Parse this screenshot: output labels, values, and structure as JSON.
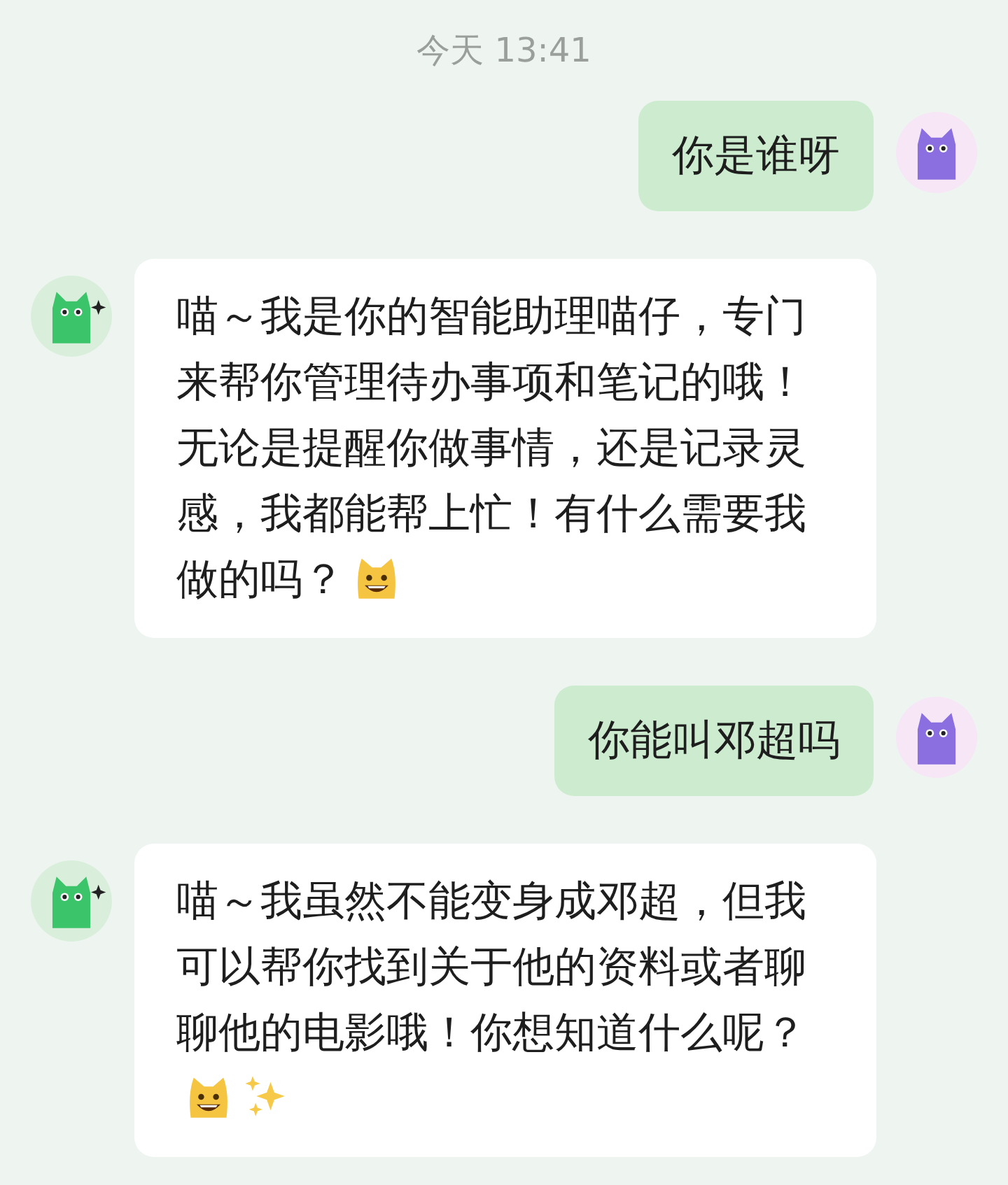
{
  "timestamp": "今天 13:41",
  "messages": [
    {
      "kind": "user",
      "text": "你是谁呀"
    },
    {
      "kind": "bot",
      "text": "喵～我是你的智能助理喵仔，专门来帮你管理待办事项和笔记的哦！无论是提醒你做事情，还是记录灵感，我都能帮上忙！有什么需要我做的吗？",
      "icons": [
        {
          "kind": "cat"
        }
      ]
    },
    {
      "kind": "user",
      "text": "你能叫邓超吗"
    },
    {
      "kind": "bot",
      "text": "喵～我虽然不能变身成邓超，但我可以帮你找到关于他的资料或者聊聊他的电影哦！你想知道什么呢？",
      "icons": [
        {
          "kind": "cat"
        },
        {
          "kind": "sparkles"
        }
      ]
    }
  ]
}
